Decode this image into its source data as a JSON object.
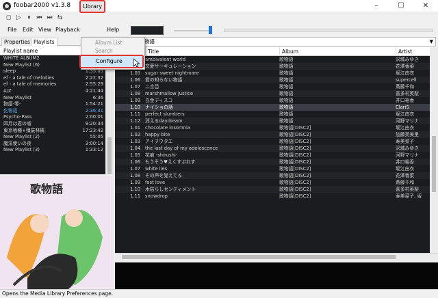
{
  "window": {
    "title": "foobar2000 v1.3.8",
    "minimize": "–",
    "maximize": "☐",
    "close": "✕"
  },
  "toolbar": [
    "stop",
    "play",
    "pause",
    "previous",
    "next",
    "random"
  ],
  "toolbar_glyphs": [
    "◻",
    "▷",
    "⏸",
    "⏮",
    "⏭",
    "⇆"
  ],
  "menu": {
    "file": "File",
    "edit": "Edit",
    "view": "View",
    "playback": "Playback",
    "library": "Library",
    "help": "Help"
  },
  "library_menu": {
    "album_list": "Album List",
    "search": "Search",
    "configure": "Configure"
  },
  "left_tabs": {
    "properties": "Properties",
    "playlists": "Playlists"
  },
  "playlist_header": "Playlist name",
  "playlists": [
    {
      "name": "WHITE ALBUM2",
      "duration": ""
    },
    {
      "name": "New Playlist (6)",
      "duration": ""
    },
    {
      "name": "sleep",
      "duration": "1:35:05"
    },
    {
      "name": "ef - a tale of melodies",
      "duration": "2:22:32"
    },
    {
      "name": "ef - a tale of memories",
      "duration": "2:55:29"
    },
    {
      "name": "A/Z",
      "duration": "4:21:44"
    },
    {
      "name": "New Playlist",
      "duration": "6:36"
    },
    {
      "name": "物語-零-",
      "duration": "1:54:21"
    },
    {
      "name": "化物語",
      "duration": "2:36:31",
      "selected": true
    },
    {
      "name": "Psycho-Pass",
      "duration": "2:00:01"
    },
    {
      "name": "四月は君の嘘",
      "duration": "9:20:34"
    },
    {
      "name": "東京喰種+殭屍林檎",
      "duration": "17:23:42"
    },
    {
      "name": "New Playlist (2)",
      "duration": "55:05"
    },
    {
      "name": "魔法使いの夜",
      "duration": "3:00:14"
    },
    {
      "name": "New Playlist (3)",
      "duration": "1:33:12"
    }
  ],
  "album_art_title": "歌物語",
  "combo": {
    "value": "物語"
  },
  "columns": {
    "title": "Title",
    "album": "Album",
    "artist": "Artist"
  },
  "tracks": [
    {
      "no": "",
      "title": "ambivalent world",
      "album": "歌物語",
      "artist": "沢城みゆき"
    },
    {
      "no": "",
      "title": "恋愛サーキュレーション",
      "album": "歌物語",
      "artist": "花澤香菜"
    },
    {
      "no": "1.05",
      "title": "sugar sweet nightmare",
      "album": "歌物語",
      "artist": "堀江由衣"
    },
    {
      "no": "1.06",
      "title": "君の知らない物語",
      "album": "歌物語",
      "artist": "supercell"
    },
    {
      "no": "1.07",
      "title": "二言目",
      "album": "歌物語",
      "artist": "斎藤千和"
    },
    {
      "no": "1.08",
      "title": "marshmallow justice",
      "album": "歌物語",
      "artist": "喜多村英梨"
    },
    {
      "no": "1.09",
      "title": "白金ディスコ",
      "album": "歌物語",
      "artist": "井口裕香"
    },
    {
      "no": "1.10",
      "title": "ナイショの話",
      "album": "歌物語",
      "artist": "ClariS",
      "selected": true
    },
    {
      "no": "1.11",
      "title": "perfect slumbers",
      "album": "歌物語",
      "artist": "堀江由衣"
    },
    {
      "no": "1.12",
      "title": "消えるdaydream",
      "album": "歌物語",
      "artist": "河野マリナ"
    },
    {
      "no": "1.01",
      "title": "chocolate insomnia",
      "album": "歌物語[DISC2]",
      "artist": "堀江由衣"
    },
    {
      "no": "1.02",
      "title": "happy bite",
      "album": "歌物語[DISC2]",
      "artist": "加藤英美里"
    },
    {
      "no": "1.03",
      "title": "アイヲウタエ",
      "album": "歌物語[DISC2]",
      "artist": "寿美菜子"
    },
    {
      "no": "1.04",
      "title": "the last day of my adolescence",
      "album": "歌物語[DISC2]",
      "artist": "沢城みゆき"
    },
    {
      "no": "1.05",
      "title": "花痕 -shirushi-",
      "album": "歌物語[DISC2]",
      "artist": "河野マリナ"
    },
    {
      "no": "1.06",
      "title": "もうそう♥えくすぷれす",
      "album": "歌物語[DISC2]",
      "artist": "井口裕香"
    },
    {
      "no": "1.07",
      "title": "white lies",
      "album": "歌物語[DISC2]",
      "artist": "堀江由衣"
    },
    {
      "no": "1.08",
      "title": "その声を覚えてる",
      "album": "歌物語[DISC2]",
      "artist": "花澤香菜"
    },
    {
      "no": "1.09",
      "title": "fast love",
      "album": "歌物語[DISC2]",
      "artist": "斎藤千和"
    },
    {
      "no": "1.10",
      "title": "木枯らしセンティメント",
      "album": "歌物語[DISC2]",
      "artist": "喜多村英梨"
    },
    {
      "no": "1.11",
      "title": "snowdrop",
      "album": "歌物語[DISC2]",
      "artist": "寿美菜子, 坂"
    }
  ],
  "status": "Opens the Media Library Preferences page.",
  "colors": {
    "highlight": "#e53030",
    "selection_text": "#5ea7e6",
    "list_bg": "#1b1c1f",
    "volume_accent": "#1e73d6"
  }
}
